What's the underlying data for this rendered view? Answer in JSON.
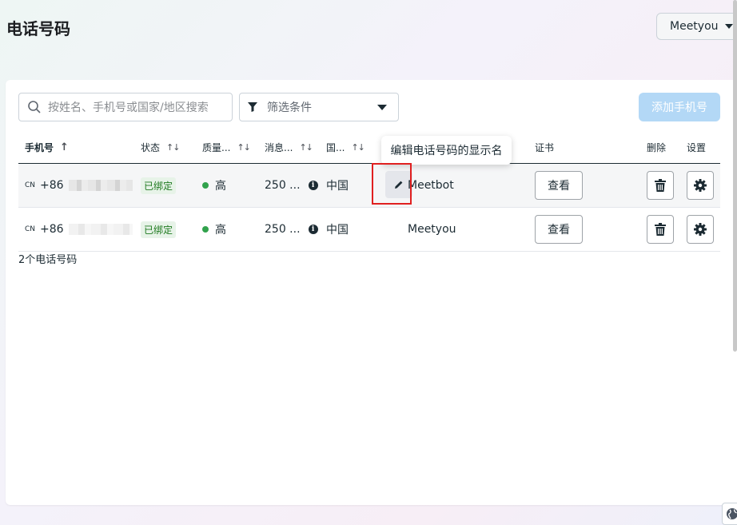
{
  "page": {
    "title": "电话号码"
  },
  "account": {
    "name": "Meetyou"
  },
  "toolbar": {
    "search_placeholder": "按姓名、手机号或国家/地区搜索",
    "filter_label": "筛选条件",
    "add_button": "添加手机号"
  },
  "table": {
    "columns": {
      "phone": "手机号",
      "status": "状态",
      "quality": "质量...",
      "message": "消息...",
      "country": "国...",
      "cert": "证书",
      "delete": "删除",
      "settings": "设置"
    },
    "rows": [
      {
        "country_code": "CN",
        "prefix": "+86",
        "status": "已绑定",
        "quality": "高",
        "message": "250 ...",
        "country": "中国",
        "display_name": "Meetbot",
        "cert_button": "查看"
      },
      {
        "country_code": "CN",
        "prefix": "+86",
        "status": "已绑定",
        "quality": "高",
        "message": "250 ...",
        "country": "中国",
        "display_name": "Meetyou",
        "cert_button": "查看"
      }
    ],
    "count_text": "2个电话号码"
  },
  "tooltip": {
    "text": "编辑电话号码的显示名"
  },
  "colors": {
    "quality_high": "#31a24c",
    "add_button_disabled": "#b3d8f6",
    "highlight": "#e02020"
  },
  "icons": [
    "search-icon",
    "filter-icon",
    "chevron-down-icon",
    "pencil-icon",
    "trash-icon",
    "gear-icon",
    "info-icon",
    "globe-icon"
  ]
}
